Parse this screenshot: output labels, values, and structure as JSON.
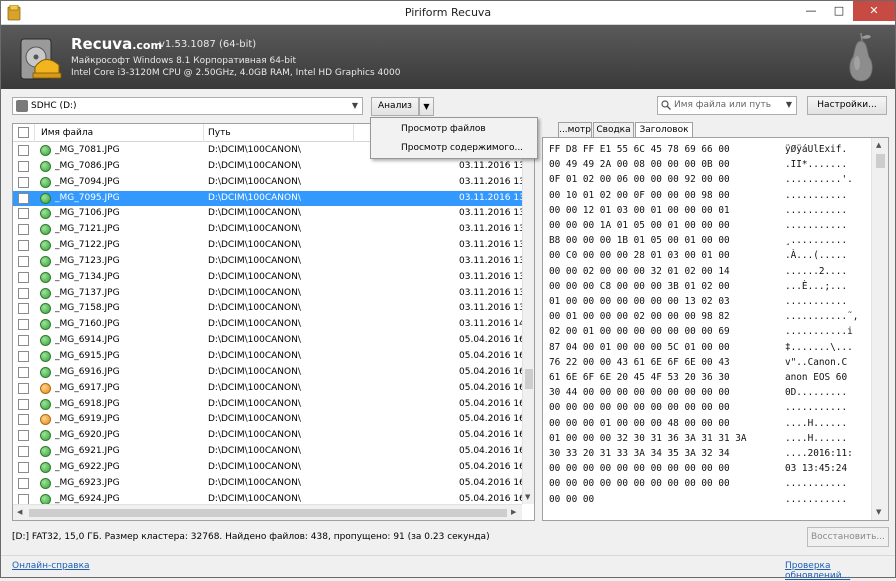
{
  "window": {
    "title": "Piriform Recuva",
    "minimize": "—",
    "maximize": "□",
    "close": "✕"
  },
  "header": {
    "brand": "Recuva",
    "brand_suffix": ".com",
    "version": "v1.53.1087 (64-bit)",
    "os_line": "Майкрософт Windows 8.1 Корпоративная 64-bit",
    "hw_line": "Intel Core i3-3120M CPU @ 2.50GHz, 4.0GB RAM, Intel HD Graphics 4000"
  },
  "toolbar": {
    "drive": "SDHC (D:)",
    "drive_icon": "sd-card-icon",
    "analyze_label": "Анализ",
    "analyze_arrow": "▼",
    "search_placeholder": "Имя файла или путь",
    "settings_label": "Настройки..."
  },
  "analyze_menu": {
    "items": [
      "Просмотр файлов",
      "Просмотр содержимого..."
    ]
  },
  "list": {
    "col_name": "Имя файла",
    "col_path": "Путь",
    "rows": [
      {
        "name": "_MG_7081.JPG",
        "path": "D:\\DCIM\\100CANON\\",
        "date": "03.11.2016 13:",
        "state": "green",
        "selected": false
      },
      {
        "name": "_MG_7086.JPG",
        "path": "D:\\DCIM\\100CANON\\",
        "date": "03.11.2016 13:",
        "state": "green",
        "selected": false
      },
      {
        "name": "_MG_7094.JPG",
        "path": "D:\\DCIM\\100CANON\\",
        "date": "03.11.2016 13:",
        "state": "green",
        "selected": false
      },
      {
        "name": "_MG_7095.JPG",
        "path": "D:\\DCIM\\100CANON\\",
        "date": "03.11.2016 13:",
        "state": "green",
        "selected": true
      },
      {
        "name": "_MG_7106.JPG",
        "path": "D:\\DCIM\\100CANON\\",
        "date": "03.11.2016 13:",
        "state": "green",
        "selected": false
      },
      {
        "name": "_MG_7121.JPG",
        "path": "D:\\DCIM\\100CANON\\",
        "date": "03.11.2016 13:",
        "state": "green",
        "selected": false
      },
      {
        "name": "_MG_7122.JPG",
        "path": "D:\\DCIM\\100CANON\\",
        "date": "03.11.2016 13:",
        "state": "green",
        "selected": false
      },
      {
        "name": "_MG_7123.JPG",
        "path": "D:\\DCIM\\100CANON\\",
        "date": "03.11.2016 13:",
        "state": "green",
        "selected": false
      },
      {
        "name": "_MG_7134.JPG",
        "path": "D:\\DCIM\\100CANON\\",
        "date": "03.11.2016 13:",
        "state": "green",
        "selected": false
      },
      {
        "name": "_MG_7137.JPG",
        "path": "D:\\DCIM\\100CANON\\",
        "date": "03.11.2016 13:",
        "state": "green",
        "selected": false
      },
      {
        "name": "_MG_7158.JPG",
        "path": "D:\\DCIM\\100CANON\\",
        "date": "03.11.2016 13:",
        "state": "green",
        "selected": false
      },
      {
        "name": "_MG_7160.JPG",
        "path": "D:\\DCIM\\100CANON\\",
        "date": "03.11.2016 14:",
        "state": "green",
        "selected": false
      },
      {
        "name": "_MG_6914.JPG",
        "path": "D:\\DCIM\\100CANON\\",
        "date": "05.04.2016 16:",
        "state": "green",
        "selected": false
      },
      {
        "name": "_MG_6915.JPG",
        "path": "D:\\DCIM\\100CANON\\",
        "date": "05.04.2016 16:",
        "state": "green",
        "selected": false
      },
      {
        "name": "_MG_6916.JPG",
        "path": "D:\\DCIM\\100CANON\\",
        "date": "05.04.2016 16:",
        "state": "green",
        "selected": false
      },
      {
        "name": "_MG_6917.JPG",
        "path": "D:\\DCIM\\100CANON\\",
        "date": "05.04.2016 16:",
        "state": "orange",
        "selected": false
      },
      {
        "name": "_MG_6918.JPG",
        "path": "D:\\DCIM\\100CANON\\",
        "date": "05.04.2016 16:",
        "state": "green",
        "selected": false
      },
      {
        "name": "_MG_6919.JPG",
        "path": "D:\\DCIM\\100CANON\\",
        "date": "05.04.2016 16:",
        "state": "orange",
        "selected": false
      },
      {
        "name": "_MG_6920.JPG",
        "path": "D:\\DCIM\\100CANON\\",
        "date": "05.04.2016 16:",
        "state": "green",
        "selected": false
      },
      {
        "name": "_MG_6921.JPG",
        "path": "D:\\DCIM\\100CANON\\",
        "date": "05.04.2016 16:",
        "state": "green",
        "selected": false
      },
      {
        "name": "_MG_6922.JPG",
        "path": "D:\\DCIM\\100CANON\\",
        "date": "05.04.2016 16:",
        "state": "green",
        "selected": false
      },
      {
        "name": "_MG_6923.JPG",
        "path": "D:\\DCIM\\100CANON\\",
        "date": "05.04.2016 16:",
        "state": "green",
        "selected": false
      },
      {
        "name": "_MG_6924.JPG",
        "path": "D:\\DCIM\\100CANON\\",
        "date": "05.04.2016 16:",
        "state": "green",
        "selected": false
      }
    ]
  },
  "tabs": {
    "items": [
      "...мотр",
      "Сводка",
      "Заголовок"
    ],
    "active": 2
  },
  "hex": {
    "bytes": [
      "FF D8 FF E1 55 6C 45 78 69 66 00",
      "00 49 49 2A 00 08 00 00 00 0B 00",
      "0F 01 02 00 06 00 00 00 92 00 00",
      "00 10 01 02 00 0F 00 00 00 98 00",
      "00 00 12 01 03 00 01 00 00 00 01",
      "00 00 00 1A 01 05 00 01 00 00 00",
      "B8 00 00 00 1B 01 05 00 01 00 00",
      "00 C0 00 00 00 28 01 03 00 01 00",
      "00 00 02 00 00 00 32 01 02 00 14",
      "00 00 00 C8 00 00 00 3B 01 02 00",
      "01 00 00 00 00 00 00 00 13 02 03",
      "00 01 00 00 00 02 00 00 00 98 82",
      "02 00 01 00 00 00 00 00 00 00 69",
      "87 04 00 01 00 00 00 5C 01 00 00",
      "76 22 00 00 43 61 6E 6F 6E 00 43",
      "61 6E 6F 6E 20 45 4F 53 20 36 30",
      "30 44 00 00 00 00 00 00 00 00 00",
      "00 00 00 00 00 00 00 00 00 00 00",
      "00 00 00 01 00 00 00 48 00 00 00",
      "01 00 00 00 32 30 31 36 3A 31 31 3A",
      "30 33 20 31 33 3A 34 35 3A 32 34",
      "00 00 00 00 00 00 00 00 00 00 00",
      "00 00 00 00 00 00 00 00 00 00 00",
      "00 00 00"
    ],
    "ascii": [
      "ÿØÿáUlExif.",
      ".II*.......",
      "..........'.",
      "...........",
      "...........",
      "...........",
      "¸..........",
      ".À...(.....",
      "......2....",
      "...È...;...",
      "...........",
      "...........˜‚",
      "...........i",
      "‡.......\\...",
      "v\"..Canon.C",
      "anon EOS 60",
      "0D.........",
      "...........",
      "....H......",
      "....H......",
      "....2016:11:",
      "03 13:45:24",
      "...........",
      "..........."
    ]
  },
  "status": {
    "text": "[D:] FAT32, 15,0 ГБ. Размер кластера: 32768. Найдено файлов: 438, пропущено: 91 (за 0.23 секунда)",
    "restore_label": "Восстановить..."
  },
  "footer": {
    "help_link": "Онлайн-справка",
    "update_link": "Проверка обновлений..."
  },
  "colors": {
    "selected_row": "#3399ff",
    "header_bg": "#4a4a4a",
    "link": "#1a5fb4",
    "close_btn": "#c74b43"
  }
}
